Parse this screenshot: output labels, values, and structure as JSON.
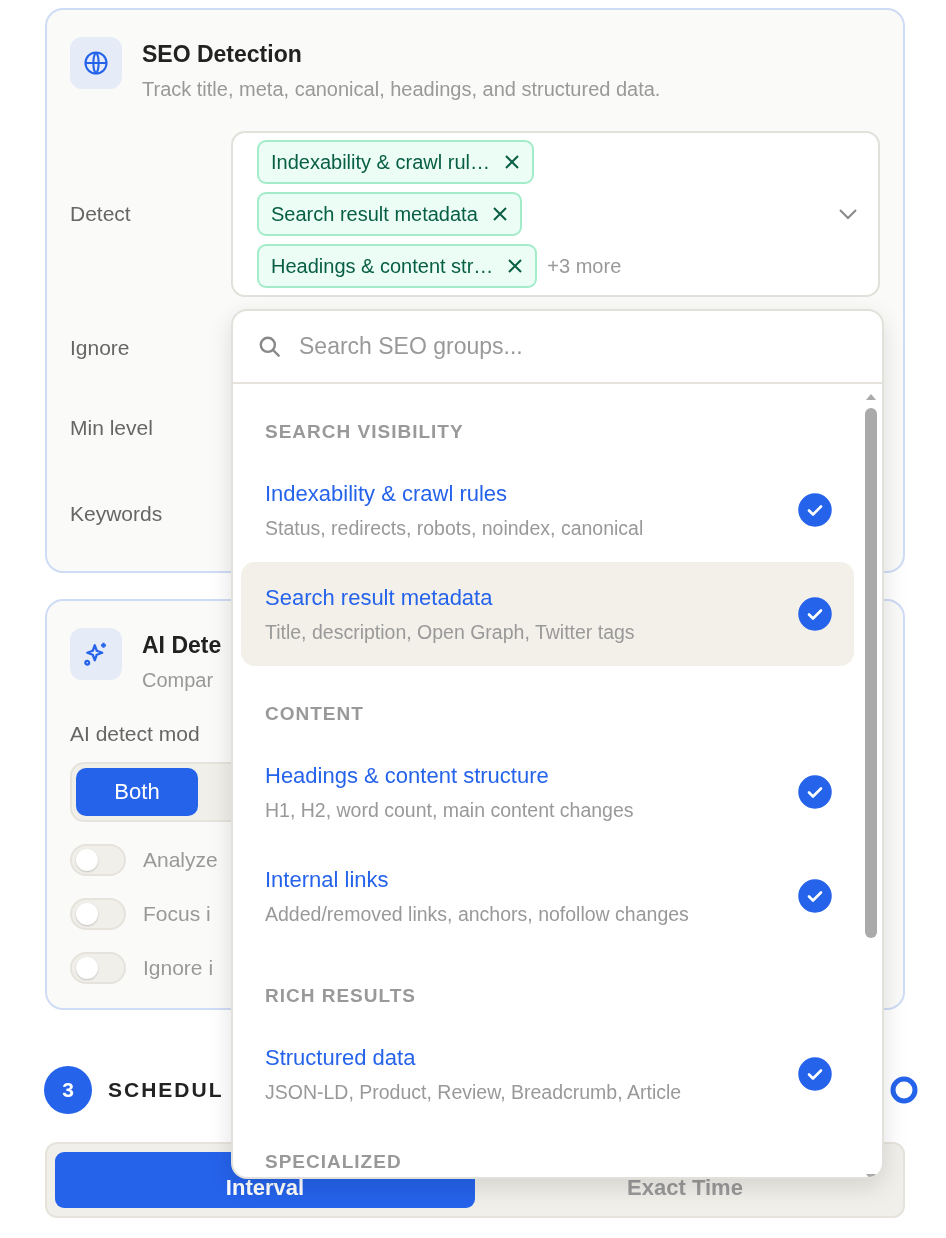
{
  "seo_card": {
    "title": "SEO Detection",
    "subtitle": "Track title, meta, canonical, headings, and structured data.",
    "detect": {
      "label": "Detect",
      "tags": [
        {
          "label": "Indexability & crawl rul…"
        },
        {
          "label": "Search result metadata"
        },
        {
          "label": "Headings & content str…"
        }
      ],
      "more": "+3 more"
    },
    "rows": [
      {
        "label": "Ignore"
      },
      {
        "label": "Min level"
      },
      {
        "label": "Keywords"
      }
    ]
  },
  "ai_card": {
    "title": "AI Dete",
    "subtitle": "Compar",
    "mode_label": "AI detect mod",
    "mode_options": [
      {
        "label": "Both",
        "selected": true
      }
    ],
    "toggles": [
      {
        "label": "Analyze",
        "on": false
      },
      {
        "label": "Focus i",
        "on": false
      },
      {
        "label": "Ignore i",
        "on": false
      }
    ]
  },
  "schedule": {
    "step": "3",
    "title": "SCHEDUL",
    "options": [
      {
        "label": "Interval",
        "selected": true
      },
      {
        "label": "Exact Time",
        "selected": false
      }
    ]
  },
  "dropdown": {
    "placeholder": "Search SEO groups...",
    "groups": [
      {
        "title": "SEARCH VISIBILITY",
        "items": [
          {
            "title": "Indexability & crawl rules",
            "description": "Status, redirects, robots, noindex, canonical",
            "checked": true,
            "selected": false
          },
          {
            "title": "Search result metadata",
            "description": "Title, description, Open Graph, Twitter tags",
            "checked": true,
            "selected": true
          }
        ]
      },
      {
        "title": "CONTENT",
        "items": [
          {
            "title": "Headings & content structure",
            "description": "H1, H2, word count, main content changes",
            "checked": true,
            "selected": false
          },
          {
            "title": "Internal links",
            "description": "Added/removed links, anchors, nofollow changes",
            "checked": true,
            "selected": false
          }
        ]
      },
      {
        "title": "RICH RESULTS",
        "items": [
          {
            "title": "Structured data",
            "description": "JSON-LD, Product, Review, Breadcrumb, Article",
            "checked": true,
            "selected": false
          }
        ]
      },
      {
        "title": "SPECIALIZED"
      }
    ]
  }
}
